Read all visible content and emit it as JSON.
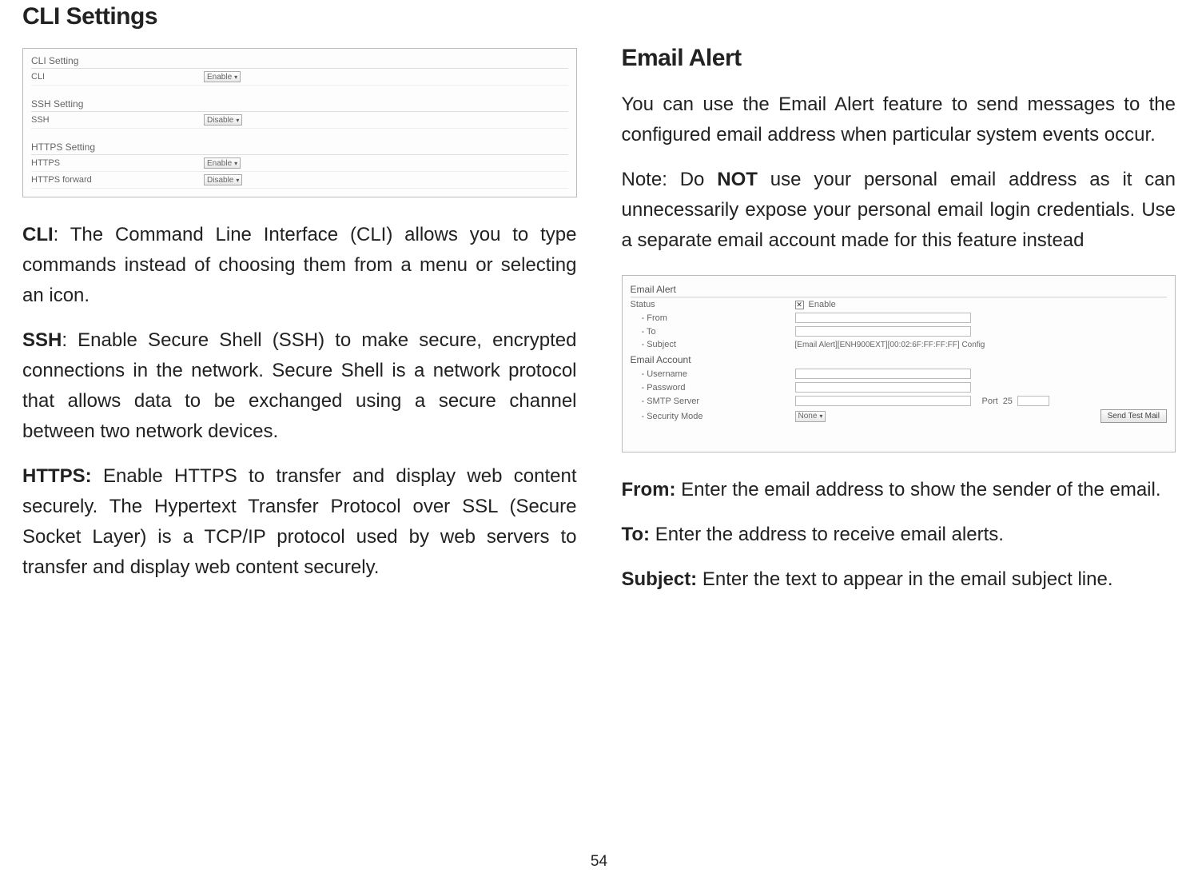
{
  "page_number": "54",
  "left": {
    "heading": "CLI Settings",
    "cli_section": "CLI Setting",
    "cli_label": "CLI",
    "cli_value": "Enable",
    "ssh_section": "SSH Setting",
    "ssh_label": "SSH",
    "ssh_value": "Disable",
    "https_section": "HTTPS Setting",
    "https_label": "HTTPS",
    "https_value": "Enable",
    "https_fwd_label": "HTTPS forward",
    "https_fwd_value": "Disable",
    "p1_bold": "CLI",
    "p1_rest": ": The Command Line Interface (CLI) allows you to type commands instead of choosing them from a menu or selecting an icon.",
    "p2_bold": "SSH",
    "p2_rest": ": Enable Secure Shell (SSH) to make secure, encrypted connections in the network. Secure Shell is a network protocol that allows data to be exchanged using a secure channel between two network devices.",
    "p3_bold": "HTTPS:",
    "p3_rest": " Enable HTTPS to transfer and display web content securely. The Hypertext Transfer Protocol over SSL (Secure Socket Layer) is a TCP/IP protocol used by web servers to transfer and display web content securely."
  },
  "right": {
    "heading": "Email Alert",
    "p1": "You can use the Email Alert feature to send messages to the configured email address when particular system events occur.",
    "note_pre": " Note: Do ",
    "note_bold": "NOT",
    "note_post": " use your personal email address as it can unnecessarily expose your personal email login credentials. Use a separate email account made for this feature instead",
    "fig": {
      "section": "Email Alert",
      "status_label": "Status",
      "enable_label": " Enable",
      "from_label": "- From",
      "to_label": "- To",
      "subject_label": "- Subject",
      "subject_value": "[Email Alert][ENH900EXT][00:02:6F:FF:FF:FF] Config",
      "account_section": "Email Account",
      "username_label": "- Username",
      "password_label": "- Password",
      "smtp_label": "- SMTP Server",
      "port_label": "Port",
      "port_value": "25",
      "security_label": "- Security Mode",
      "security_value": "None",
      "button": "Send Test Mail"
    },
    "from_bold": "From:",
    "from_rest": " Enter the email address to show the sender of the email.",
    "to_bold": "To:",
    "to_rest": " Enter the address to receive email alerts.",
    "subj_bold": "Subject:",
    "subj_rest": " Enter the text to appear in the email subject line."
  }
}
